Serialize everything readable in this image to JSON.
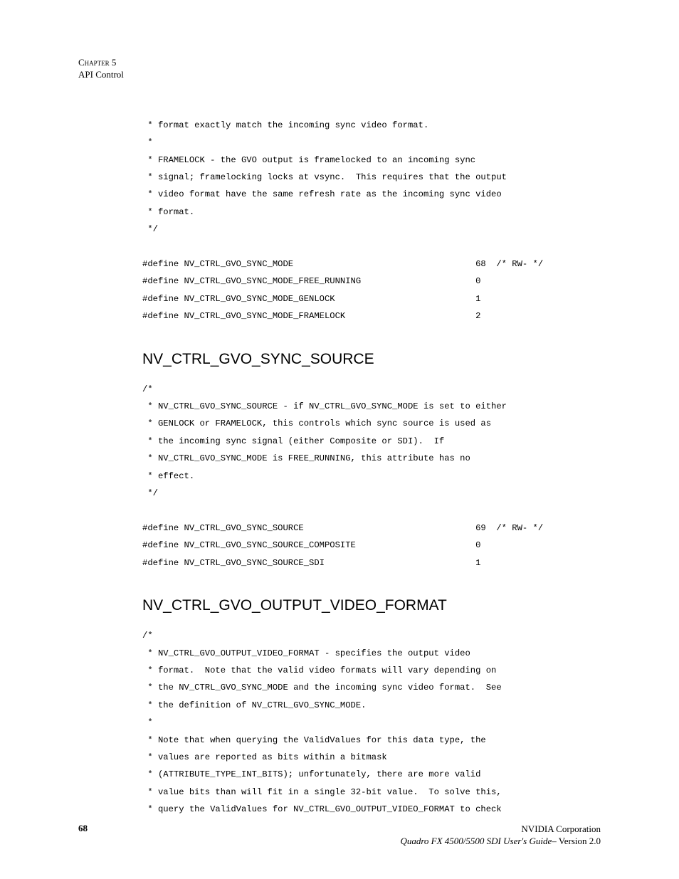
{
  "header": {
    "chapterLine": "Chapter 5",
    "subtitle": "API Control"
  },
  "sections": {
    "block1": {
      "code": " * format exactly match the incoming sync video format.\n *\n * FRAMELOCK - the GVO output is framelocked to an incoming sync\n * signal; framelocking locks at vsync.  This requires that the output\n * video format have the same refresh rate as the incoming sync video\n * format.\n */\n\n#define NV_CTRL_GVO_SYNC_MODE                                   68  /* RW- */\n#define NV_CTRL_GVO_SYNC_MODE_FREE_RUNNING                      0\n#define NV_CTRL_GVO_SYNC_MODE_GENLOCK                           1\n#define NV_CTRL_GVO_SYNC_MODE_FRAMELOCK                         2"
    },
    "syncSource": {
      "title": "NV_CTRL_GVO_SYNC_SOURCE",
      "code": "/*\n * NV_CTRL_GVO_SYNC_SOURCE - if NV_CTRL_GVO_SYNC_MODE is set to either\n * GENLOCK or FRAMELOCK, this controls which sync source is used as\n * the incoming sync signal (either Composite or SDI).  If\n * NV_CTRL_GVO_SYNC_MODE is FREE_RUNNING, this attribute has no\n * effect.\n */\n\n#define NV_CTRL_GVO_SYNC_SOURCE                                 69  /* RW- */\n#define NV_CTRL_GVO_SYNC_SOURCE_COMPOSITE                       0\n#define NV_CTRL_GVO_SYNC_SOURCE_SDI                             1"
    },
    "outputFormat": {
      "title": "NV_CTRL_GVO_OUTPUT_VIDEO_FORMAT",
      "code": "/*\n * NV_CTRL_GVO_OUTPUT_VIDEO_FORMAT - specifies the output video\n * format.  Note that the valid video formats will vary depending on\n * the NV_CTRL_GVO_SYNC_MODE and the incoming sync video format.  See\n * the definition of NV_CTRL_GVO_SYNC_MODE.\n *\n * Note that when querying the ValidValues for this data type, the\n * values are reported as bits within a bitmask\n * (ATTRIBUTE_TYPE_INT_BITS); unfortunately, there are more valid\n * value bits than will fit in a single 32-bit value.  To solve this,\n * query the ValidValues for NV_CTRL_GVO_OUTPUT_VIDEO_FORMAT to check"
    }
  },
  "footer": {
    "pageNumber": "68",
    "corp": "NVIDIA Corporation",
    "docTitle": "Quadro FX 4500/5500 SDI User's Guide",
    "version": "– Version 2.0"
  }
}
